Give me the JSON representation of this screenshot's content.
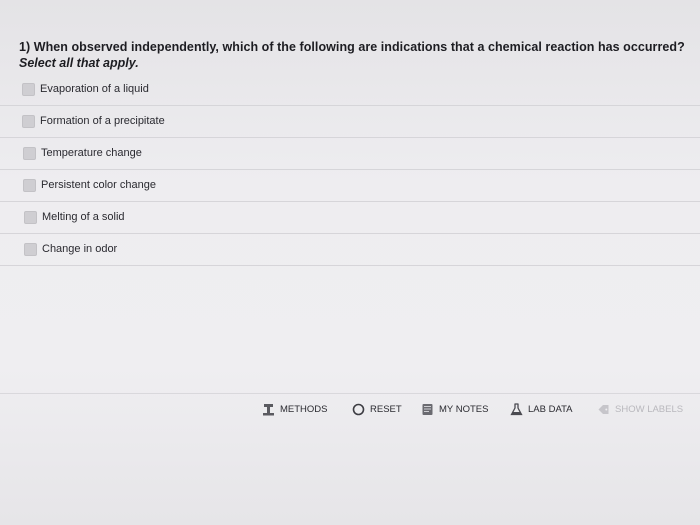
{
  "question": {
    "title": "1) When observed independently, which of the following are indications that a chemical reaction has occurred?",
    "instruction": "Select all that apply."
  },
  "options": [
    {
      "label": "Evaporation of a liquid",
      "checked": false
    },
    {
      "label": "Formation of a precipitate",
      "checked": false
    },
    {
      "label": "Temperature change",
      "checked": false
    },
    {
      "label": "Persistent color change",
      "checked": false
    },
    {
      "label": "Melting of a solid",
      "checked": false
    },
    {
      "label": "Change in odor",
      "checked": false
    }
  ],
  "toolbar": {
    "methods": "METHODS",
    "reset": "RESET",
    "my_notes": "MY NOTES",
    "lab_data": "LAB DATA",
    "show_labels": "SHOW LABELS"
  },
  "icons": {
    "methods": "flask-stand-icon",
    "reset": "circle-reset-icon",
    "my_notes": "notepad-icon",
    "lab_data": "beaker-icon",
    "show_labels": "tag-icon"
  }
}
